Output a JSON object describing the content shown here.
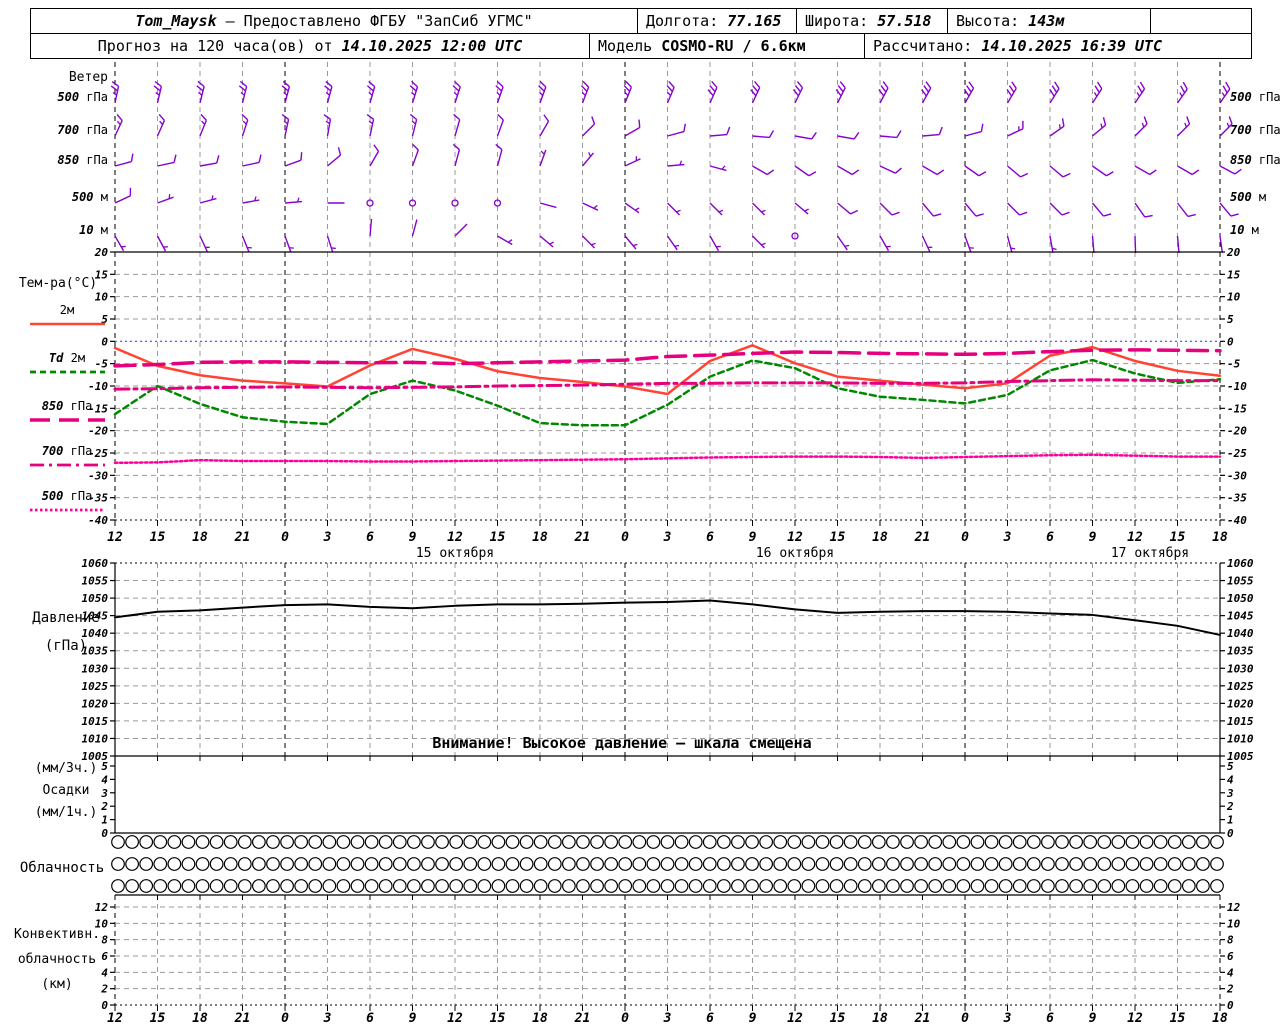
{
  "header": {
    "row1": {
      "station": "Tom_Maysk",
      "provider": "— Предоставлено ФГБУ \"ЗапСиб УГМС\"",
      "lon_label": "Долгота:",
      "lon": "77.165",
      "lat_label": "Широта:",
      "lat": "57.518",
      "alt_label": "Высота:",
      "alt": "143м"
    },
    "row2": {
      "forecast_label": "Прогноз на 120 часа(ов) от",
      "forecast_time": "14.10.2025 12:00 UTC",
      "model_label": "Модель",
      "model": "COSMO-RU / 6.6км",
      "calc_label": "Рассчитано:",
      "calc_time": "14.10.2025 16:39 UTC"
    }
  },
  "colors": {
    "barb_purple": "#8800cc",
    "temp_2m_red": "#ff4433",
    "td_green": "#008800",
    "magenta_850_700": "#e6007e",
    "magenta_500": "#ff0099",
    "zero_line_blue": "#4444ff",
    "grid_gray": "#999999",
    "axis_black": "#000000"
  },
  "axis": {
    "hours": [
      "12",
      "15",
      "18",
      "21",
      "0",
      "3",
      "6",
      "9",
      "12",
      "15",
      "18",
      "21",
      "0",
      "3",
      "6",
      "9",
      "12",
      "15",
      "18",
      "21",
      "0",
      "3",
      "6",
      "9",
      "12",
      "15",
      "18"
    ],
    "step_hours": 3,
    "start": "14.10 12:00 UTC",
    "dates": [
      {
        "label": "15 октября",
        "tick": 8
      },
      {
        "label": "16 октября",
        "tick": 16
      },
      {
        "label": "17 октября",
        "tick": 24
      }
    ]
  },
  "panels": {
    "wind": {
      "title": "Ветер",
      "level_labels": [
        [
          {
            "t": "500",
            "i": 1
          },
          {
            "t": " гПа",
            "i": 0
          }
        ],
        [
          {
            "t": "700",
            "i": 1
          },
          {
            "t": " гПа",
            "i": 0
          }
        ],
        [
          {
            "t": "850",
            "i": 1
          },
          {
            "t": " гПа",
            "i": 0
          }
        ],
        [
          {
            "t": "500",
            "i": 1
          },
          {
            "t": " м",
            "i": 0
          }
        ],
        [
          {
            "t": "10",
            "i": 1
          },
          {
            "t": " м",
            "i": 0
          }
        ]
      ]
    },
    "temperature": {
      "title": "Тем-ра(°C)",
      "yticks": [
        20,
        15,
        10,
        5,
        0,
        -5,
        -10,
        -15,
        -20,
        -25,
        -30,
        -35,
        -40
      ]
    },
    "pressure": {
      "title_1": "Давление",
      "title_2": "(гПа)",
      "yticks": [
        1060,
        1055,
        1050,
        1045,
        1040,
        1035,
        1030,
        1025,
        1020,
        1015,
        1010,
        1005
      ],
      "warning": "Внимание! Высокое давление — шкала смещена"
    },
    "precip": {
      "title_1": "(мм/3ч.)",
      "title_2": "Осадки",
      "title_3": "(мм/1ч.)",
      "yticks": [
        5,
        4,
        3,
        2,
        1,
        0
      ]
    },
    "cloud": {
      "title": "Облачность",
      "rows": 3,
      "circles_per_row": 79,
      "circle_state": "open"
    },
    "convective": {
      "title_1": "Конвективн.",
      "title_2": "облачность",
      "title_3": "(км)",
      "yticks": [
        12,
        10,
        8,
        6,
        4,
        2,
        0
      ]
    }
  },
  "chart_data": [
    {
      "type": "wind-barbs",
      "title": "Ветер",
      "levels": [
        "500 гПа",
        "700 гПа",
        "850 гПа",
        "500 м",
        "10 м"
      ],
      "series": [
        {
          "name": "500 гПа",
          "staff_angle_deg": [
            78,
            77,
            76,
            76,
            75,
            75,
            74,
            73,
            72,
            71,
            70,
            69,
            68,
            67,
            66,
            65,
            64,
            63,
            62,
            61,
            60,
            59,
            58,
            57,
            56,
            55,
            55
          ],
          "speed_kt": [
            25,
            25,
            25,
            25,
            25,
            25,
            25,
            25,
            25,
            25,
            25,
            25,
            25,
            25,
            30,
            30,
            30,
            30,
            30,
            30,
            30,
            30,
            30,
            25,
            25,
            25,
            25
          ]
        },
        {
          "name": "700 гПа",
          "staff_angle_deg": [
            65,
            66,
            68,
            72,
            78,
            80,
            78,
            76,
            74,
            70,
            60,
            45,
            30,
            15,
            5,
            -5,
            -10,
            -10,
            -5,
            5,
            15,
            25,
            35,
            40,
            45,
            45,
            45
          ],
          "speed_kt": [
            15,
            15,
            15,
            15,
            15,
            15,
            15,
            15,
            10,
            10,
            10,
            10,
            10,
            10,
            10,
            10,
            10,
            10,
            10,
            10,
            10,
            15,
            15,
            15,
            15,
            15,
            15
          ]
        },
        {
          "name": "850 гПа",
          "staff_angle_deg": [
            15,
            12,
            10,
            12,
            20,
            40,
            60,
            70,
            75,
            75,
            70,
            50,
            25,
            5,
            -15,
            -30,
            -35,
            -30,
            -25,
            -30,
            -35,
            -40,
            -40,
            -35,
            -30,
            -30,
            -28
          ],
          "speed_kt": [
            10,
            10,
            10,
            10,
            10,
            10,
            10,
            10,
            10,
            10,
            5,
            5,
            5,
            5,
            5,
            10,
            10,
            10,
            10,
            10,
            10,
            10,
            10,
            10,
            10,
            10,
            10
          ]
        },
        {
          "name": "500 м",
          "staff_angle_deg": [
            25,
            20,
            15,
            10,
            5,
            0,
            0,
            0,
            0,
            0,
            -15,
            -25,
            -35,
            -45,
            -45,
            -45,
            -40,
            -40,
            -45,
            -50,
            -50,
            -45,
            -45,
            -50,
            -55,
            -52,
            -50
          ],
          "speed_kt": [
            10,
            8,
            5,
            5,
            5,
            3,
            0,
            0,
            0,
            0,
            3,
            5,
            5,
            5,
            5,
            5,
            8,
            10,
            10,
            10,
            10,
            10,
            10,
            10,
            10,
            10,
            10
          ]
        },
        {
          "name": "10 м",
          "staff_angle_deg": [
            -60,
            -62,
            -65,
            -68,
            -70,
            -72,
            85,
            75,
            45,
            -30,
            -40,
            -45,
            -50,
            -55,
            -60,
            -45,
            0,
            -55,
            -60,
            -65,
            -70,
            -75,
            -80,
            -85,
            -88,
            -85,
            -82
          ],
          "speed_kt": [
            5,
            5,
            5,
            5,
            5,
            5,
            2,
            2,
            2,
            5,
            5,
            5,
            5,
            5,
            5,
            5,
            0,
            5,
            5,
            5,
            5,
            5,
            5,
            3,
            3,
            3,
            3
          ]
        }
      ]
    },
    {
      "type": "line",
      "title": "Тем-ра(°C)",
      "ylabel": "°C",
      "ylim": [
        -40,
        20
      ],
      "grid": true,
      "zero_line": true,
      "legend_position": "left",
      "series": [
        {
          "name": "2м",
          "name_parts": [
            {
              "t": "2м",
              "i": 0
            }
          ],
          "color": "#ff4433",
          "dash": "solid",
          "values": [
            -1.5,
            -5.5,
            -7.6,
            -8.8,
            -9.4,
            -10.1,
            -5.4,
            -1.7,
            -3.9,
            -6.7,
            -8.2,
            -9.1,
            -10.1,
            -11.8,
            -4.4,
            -0.9,
            -4.9,
            -7.9,
            -8.8,
            -9.7,
            -10.5,
            -9.4,
            -3.2,
            -1.3,
            -4.4,
            -6.6,
            -7.7
          ]
        },
        {
          "name": "Td 2м",
          "name_parts": [
            {
              "t": "Td ",
              "i": 1
            },
            {
              "t": " 2м",
              "i": 0
            }
          ],
          "color": "#008800",
          "dash": "dashed",
          "values": [
            -16.3,
            -10.0,
            -14.0,
            -17.0,
            -18.0,
            -18.5,
            -11.8,
            -8.8,
            -11.0,
            -14.4,
            -18.3,
            -18.8,
            -18.8,
            -14.2,
            -7.9,
            -4.3,
            -6.0,
            -10.5,
            -12.4,
            -13.1,
            -13.9,
            -12.0,
            -6.5,
            -4.2,
            -7.2,
            -9.3,
            -8.5
          ]
        },
        {
          "name": "850 гПа",
          "name_parts": [
            {
              "t": "850",
              "i": 1
            },
            {
              "t": " гПа",
              "i": 0
            }
          ],
          "color": "#e6007e",
          "dash": "longdash",
          "values": [
            -5.5,
            -5.2,
            -4.7,
            -4.6,
            -4.6,
            -4.7,
            -4.8,
            -4.7,
            -5.0,
            -4.8,
            -4.6,
            -4.4,
            -4.2,
            -3.4,
            -3.1,
            -2.7,
            -2.4,
            -2.5,
            -2.7,
            -2.8,
            -2.9,
            -2.7,
            -2.3,
            -2.0,
            -1.9,
            -2.0,
            -2.1
          ]
        },
        {
          "name": "700 гПа",
          "name_parts": [
            {
              "t": "700",
              "i": 1
            },
            {
              "t": " гПа",
              "i": 0
            }
          ],
          "color": "#e6007e",
          "dash": "dashdot",
          "values": [
            -10.7,
            -10.6,
            -10.4,
            -10.3,
            -10.2,
            -10.3,
            -10.4,
            -10.3,
            -10.2,
            -10.0,
            -9.9,
            -9.8,
            -9.6,
            -9.4,
            -9.4,
            -9.3,
            -9.3,
            -9.3,
            -9.4,
            -9.4,
            -9.3,
            -9.0,
            -8.8,
            -8.6,
            -8.7,
            -8.8,
            -8.8
          ]
        },
        {
          "name": "500 гПа",
          "name_parts": [
            {
              "t": "500",
              "i": 1
            },
            {
              "t": " гПа",
              "i": 0
            }
          ],
          "color": "#ff0099",
          "dash": "dotted",
          "values": [
            -27.2,
            -27.1,
            -26.6,
            -26.8,
            -26.8,
            -26.8,
            -26.9,
            -26.9,
            -26.8,
            -26.7,
            -26.6,
            -26.5,
            -26.4,
            -26.2,
            -26.0,
            -25.9,
            -25.8,
            -25.8,
            -25.9,
            -26.1,
            -25.9,
            -25.7,
            -25.5,
            -25.4,
            -25.6,
            -25.8,
            -25.8
          ]
        }
      ]
    },
    {
      "type": "line",
      "title": "Давление (гПа)",
      "ylim": [
        1005,
        1060
      ],
      "grid": true,
      "annotation": "Внимание! Высокое давление — шкала смещена",
      "series": [
        {
          "name": "Давление",
          "color": "#000000",
          "dash": "solid",
          "values": [
            1044.5,
            1046.1,
            1046.5,
            1047.3,
            1048.0,
            1048.2,
            1047.5,
            1047.1,
            1047.8,
            1048.2,
            1048.2,
            1048.4,
            1048.7,
            1048.9,
            1049.3,
            1048.2,
            1046.8,
            1045.8,
            1046.1,
            1046.3,
            1046.3,
            1046.1,
            1045.6,
            1045.2,
            1043.7,
            1042.1,
            1039.5
          ]
        }
      ]
    },
    {
      "type": "bar",
      "title": "Осадки (мм/3ч.)(мм/1ч.)",
      "ylim": [
        0,
        5
      ],
      "values": []
    },
    {
      "type": "cloud-cover",
      "title": "Облачность",
      "rows": 3,
      "symbols_per_row": 79,
      "symbol": "open-circle",
      "coverage_octas": 0
    },
    {
      "type": "line",
      "title": "Конвективн. облачность (км)",
      "ylim": [
        0,
        12
      ],
      "series": [
        {
          "name": "Конвективная облачность",
          "values": []
        }
      ]
    }
  ]
}
